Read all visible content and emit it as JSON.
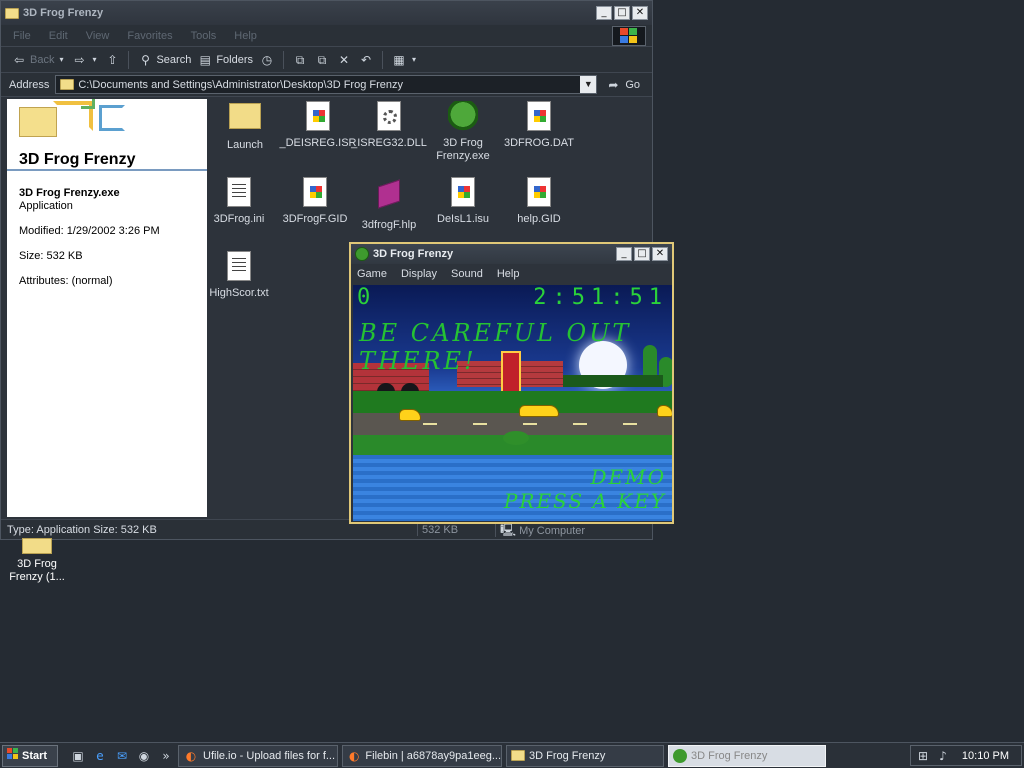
{
  "explorer": {
    "title": "3D Frog Frenzy",
    "menu": [
      "File",
      "Edit",
      "View",
      "Favorites",
      "Tools",
      "Help"
    ],
    "toolbar": {
      "back": "Back",
      "search": "Search",
      "folders": "Folders"
    },
    "address": {
      "label": "Address",
      "path": "C:\\Documents and Settings\\Administrator\\Desktop\\3D Frog Frenzy",
      "go": "Go"
    },
    "details": {
      "heading": "3D Frog Frenzy",
      "file_name": "3D Frog Frenzy.exe",
      "file_type": "Application",
      "modified": "Modified: 1/29/2002 3:26 PM",
      "size": "Size: 532 KB",
      "attributes": "Attributes: (normal)"
    },
    "files": [
      {
        "name": "Launch",
        "icon": "folder-icon"
      },
      {
        "name": "_DEISREG.ISR",
        "icon": "windows-file-icon"
      },
      {
        "name": "_ISREG32.DLL",
        "icon": "dll-file-icon"
      },
      {
        "name": "3D Frog Frenzy.exe",
        "icon": "frog-app-icon"
      },
      {
        "name": "3DFROG.DAT",
        "icon": "windows-file-icon"
      },
      {
        "name": "3DFrog.ini",
        "icon": "ini-file-icon"
      },
      {
        "name": "3DFrogF.GID",
        "icon": "windows-file-icon"
      },
      {
        "name": "3dfrogF.hlp",
        "icon": "help-book-icon"
      },
      {
        "name": "DeIsL1.isu",
        "icon": "windows-file-icon"
      },
      {
        "name": "help.GID",
        "icon": "windows-file-icon"
      },
      {
        "name": "HighScor.txt",
        "icon": "text-file-icon"
      }
    ],
    "status": {
      "main": "Type: Application Size: 532 KB",
      "size": "532 KB",
      "zone": "My Computer"
    }
  },
  "desktop_icon": {
    "label": "3D Frog Frenzy (1..."
  },
  "game": {
    "title": "3D Frog Frenzy",
    "menu": [
      "Game",
      "Display",
      "Sound",
      "Help"
    ],
    "score": "0",
    "timer": "2:51:51",
    "message": "BE CAREFUL OUT THERE!",
    "demo_line1": "DEMO",
    "demo_line2": "PRESS A KEY"
  },
  "taskbar": {
    "start": "Start",
    "tasks": [
      {
        "label": "Ufile.io - Upload files for f...",
        "icon": "firefox-icon",
        "active": false
      },
      {
        "label": "Filebin | a6878ay9pa1eeg...",
        "icon": "firefox-icon",
        "active": false
      },
      {
        "label": "3D Frog Frenzy",
        "icon": "folder-icon",
        "active": false
      },
      {
        "label": "3D Frog Frenzy",
        "icon": "frog-app-icon",
        "active": true
      }
    ],
    "clock": "10:10 PM"
  },
  "colors": {
    "desktop": "#252b33",
    "hud_green": "#2bd23a",
    "active_border": "#e0c878"
  }
}
